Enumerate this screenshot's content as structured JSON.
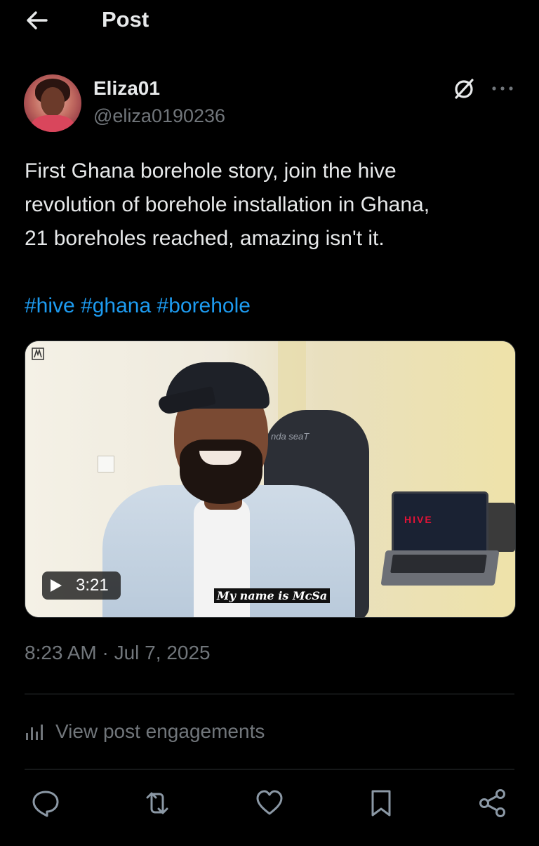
{
  "header": {
    "title": "Post",
    "back_icon": "arrow-left-icon"
  },
  "author": {
    "display_name": "Eliza01",
    "handle": "@eliza0190236",
    "avatar_icon": "avatar-photo"
  },
  "post": {
    "text_lines": [
      "First Ghana borehole story, join the hive",
      "revolution of borehole installation in Ghana,",
      "21 boreholes reached, amazing isn't it."
    ],
    "hashtags": [
      "#hive",
      "#ghana",
      "#borehole"
    ],
    "timestamp": "8:23 AM · Jul 7, 2025"
  },
  "media": {
    "type": "video",
    "duration": "3:21",
    "subtitle": "My name is McSa",
    "chair_brand": "nda seaT",
    "laptop_logo": "HIVE"
  },
  "engagements": {
    "label": "View post engagements",
    "icon": "bar-chart-icon"
  },
  "actions": [
    {
      "name": "reply",
      "icon": "reply-icon"
    },
    {
      "name": "repost",
      "icon": "repost-icon"
    },
    {
      "name": "like",
      "icon": "heart-icon"
    },
    {
      "name": "bookmark",
      "icon": "bookmark-icon"
    },
    {
      "name": "share",
      "icon": "share-icon"
    }
  ],
  "colors": {
    "background": "#000000",
    "text_primary": "#e7e9ea",
    "text_secondary": "#71767b",
    "link": "#1d9bf0",
    "divider": "#2f3336"
  }
}
